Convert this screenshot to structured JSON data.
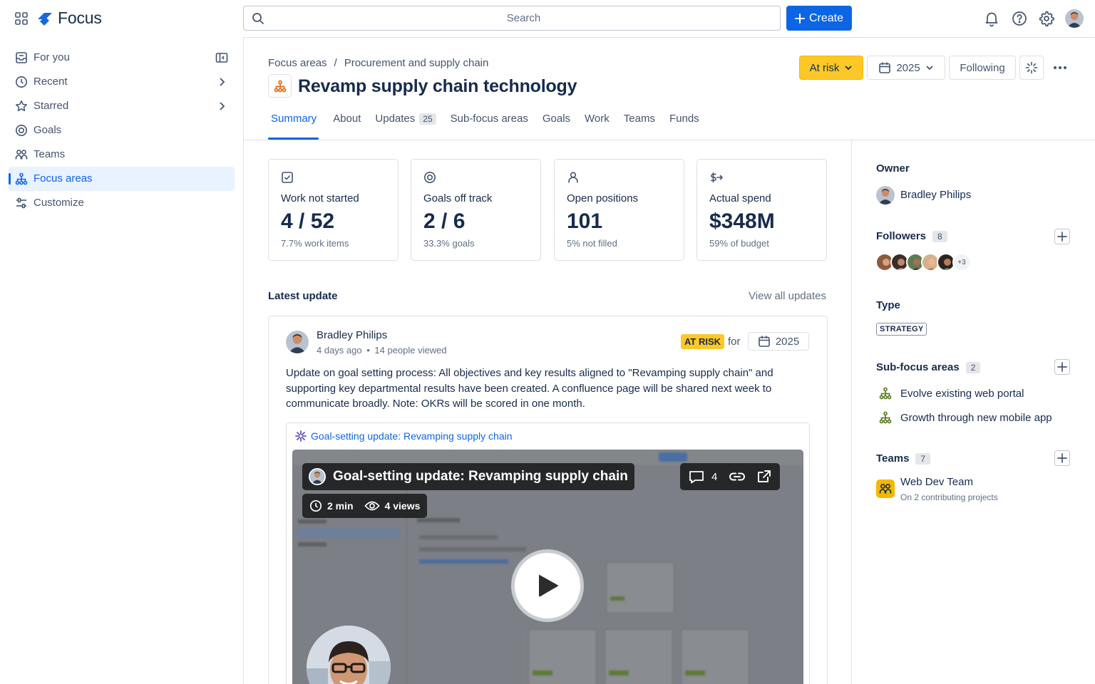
{
  "app": {
    "name": "Focus"
  },
  "search": {
    "placeholder": "Search"
  },
  "header": {
    "create_label": "Create"
  },
  "sidebar": {
    "items": [
      {
        "label": "For you"
      },
      {
        "label": "Recent"
      },
      {
        "label": "Starred"
      },
      {
        "label": "Goals"
      },
      {
        "label": "Teams"
      },
      {
        "label": "Focus areas",
        "active": true
      },
      {
        "label": "Customize"
      }
    ]
  },
  "breadcrumb": {
    "root": "Focus areas",
    "separator": "/",
    "current": "Procurement and supply chain"
  },
  "page": {
    "title": "Revamp supply chain technology",
    "status_label": "At risk",
    "year_label": "2025",
    "follow_label": "Following"
  },
  "tabs": [
    {
      "label": "Summary",
      "active": true
    },
    {
      "label": "About"
    },
    {
      "label": "Updates",
      "count": "25"
    },
    {
      "label": "Sub-focus areas"
    },
    {
      "label": "Goals"
    },
    {
      "label": "Work"
    },
    {
      "label": "Teams"
    },
    {
      "label": "Funds"
    }
  ],
  "stats": [
    {
      "icon": "checkbox-icon",
      "title": "Work not started",
      "value": "4 / 52",
      "sub": "7.7% work items"
    },
    {
      "icon": "target-icon",
      "title": "Goals off track",
      "value": "2 / 6",
      "sub": "33.3% goals"
    },
    {
      "icon": "person-icon",
      "title": "Open positions",
      "value": "101",
      "sub": "5% not filled"
    },
    {
      "icon": "dollar-arrow-icon",
      "title": "Actual spend",
      "value": "$348M",
      "sub": "59% of budget"
    }
  ],
  "latest_update": {
    "heading": "Latest update",
    "view_all": "View all updates",
    "author": "Bradley Philips",
    "time": "4 days ago",
    "dot": "•",
    "views": "14 people viewed",
    "status": "AT RISK",
    "for_label": "for",
    "year": "2025",
    "body": "Update on goal setting process: All objectives and key results aligned to \"Revamping supply chain\" and supporting key departmental results have been created. A confluence page will be shared next week to communicate broadly. Note: OKRs will be scored in one month.",
    "loom": {
      "link_title": "Goal-setting update: Revamping supply chain",
      "video_title": "Goal-setting update: Revamping supply chain",
      "comments": "4",
      "duration": "2 min",
      "views": "4 views"
    }
  },
  "panel": {
    "owner_heading": "Owner",
    "owner_name": "Bradley Philips",
    "followers_heading": "Followers",
    "followers_count": "8",
    "followers_more": "+3",
    "type_heading": "Type",
    "type_value": "STRATEGY",
    "sub_heading": "Sub-focus areas",
    "sub_count": "2",
    "sub_items": [
      "Evolve existing web portal",
      "Growth through new mobile app"
    ],
    "teams_heading": "Teams",
    "teams_count": "7",
    "team_name": "Web Dev Team",
    "team_sub": "On 2 contributing projects"
  },
  "colors": {
    "accent": "#0c66e4",
    "at_risk": "#fbc828",
    "focus_icon": "#e56910",
    "sub_icon": "#5b7f24",
    "team_icon_bg": "#f5b800"
  }
}
